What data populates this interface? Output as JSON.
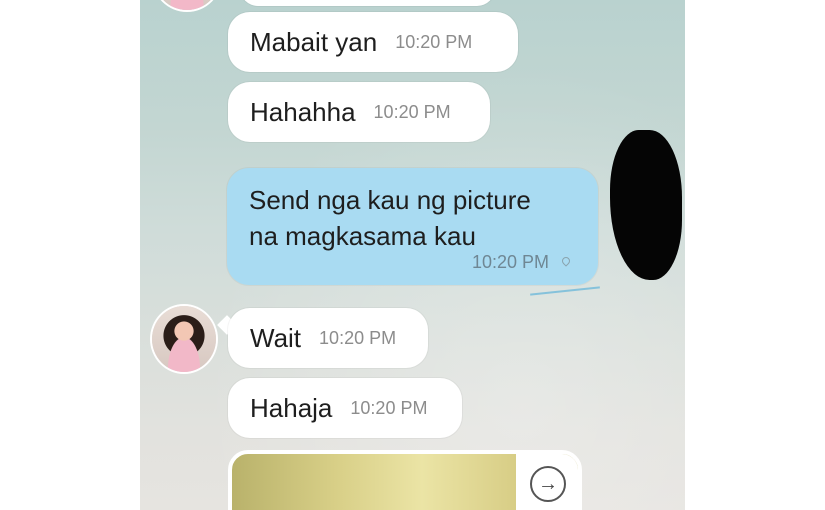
{
  "messages": [
    {
      "direction": "incoming",
      "text": "Mabait yan",
      "time": "10:20 PM"
    },
    {
      "direction": "incoming",
      "text": "Hahahha",
      "time": "10:20 PM"
    },
    {
      "direction": "outgoing",
      "lines": [
        "Send nga kau ng picture",
        "na magkasama kau"
      ],
      "time": "10:20 PM",
      "status_icon": "location-pin-icon"
    },
    {
      "direction": "incoming",
      "text": "Wait",
      "time": "10:20 PM",
      "has_avatar": true
    },
    {
      "direction": "incoming",
      "text": "Hahaja",
      "time": "10:20 PM"
    },
    {
      "direction": "incoming",
      "type": "image",
      "action_icon": "share-forward-icon"
    }
  ],
  "colors": {
    "incoming_bubble": "#ffffff",
    "outgoing_bubble": "#a9dbf2",
    "timestamp": "#8c8c8c"
  },
  "icons": {
    "share": "→"
  }
}
